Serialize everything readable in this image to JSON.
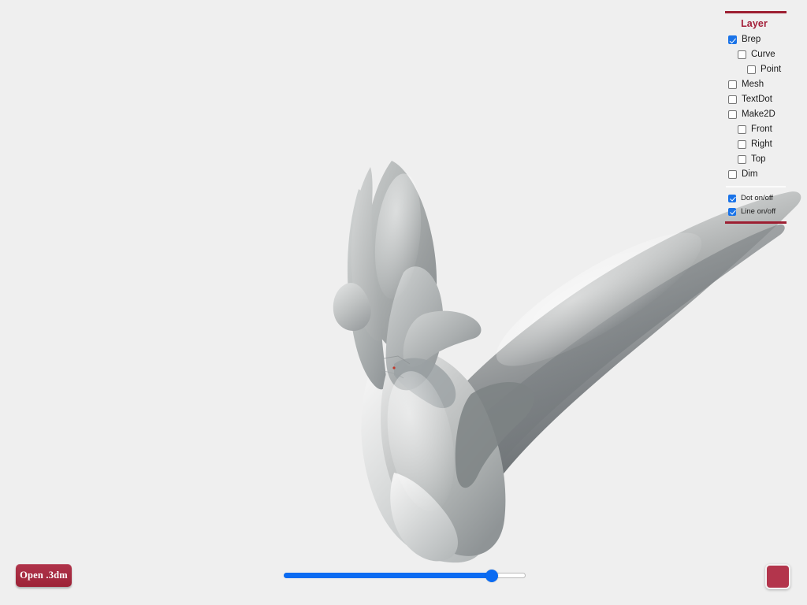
{
  "app": {
    "background_color": "#efefef",
    "accent_color": "#a4203a",
    "checkbox_color": "#1a73e8",
    "slider_color": "#0b6bf2"
  },
  "viewport": {
    "name": "3d-model-viewport",
    "description": "Shaded grey 3D surface model (Rhino .3dm Brep) shown on a light grey background"
  },
  "layer_panel": {
    "title": "Layer",
    "items": [
      {
        "label": "Brep",
        "checked": true,
        "indent": 0,
        "size": "normal"
      },
      {
        "label": "Curve",
        "checked": false,
        "indent": 1,
        "size": "normal"
      },
      {
        "label": "Point",
        "checked": false,
        "indent": 2,
        "size": "normal"
      },
      {
        "label": "Mesh",
        "checked": false,
        "indent": 0,
        "size": "normal"
      },
      {
        "label": "TextDot",
        "checked": false,
        "indent": 0,
        "size": "normal"
      },
      {
        "label": "Make2D",
        "checked": false,
        "indent": 0,
        "size": "normal"
      },
      {
        "label": "Front",
        "checked": false,
        "indent": 1,
        "size": "normal"
      },
      {
        "label": "Right",
        "checked": false,
        "indent": 1,
        "size": "normal"
      },
      {
        "label": "Top",
        "checked": false,
        "indent": 1,
        "size": "normal"
      },
      {
        "label": "Dim",
        "checked": false,
        "indent": 0,
        "size": "normal"
      }
    ],
    "toggles": [
      {
        "label": "Dot on/off",
        "checked": true,
        "indent": 0,
        "size": "small"
      },
      {
        "label": "Line on/off",
        "checked": true,
        "indent": 0,
        "size": "small"
      }
    ]
  },
  "controls": {
    "open_button_label": "Open .3dm",
    "slider": {
      "name": "view-slider",
      "value": 88,
      "min": 0,
      "max": 100
    },
    "color_swatch": {
      "name": "color-swatch-button",
      "color": "#b3354c",
      "label": ""
    }
  }
}
